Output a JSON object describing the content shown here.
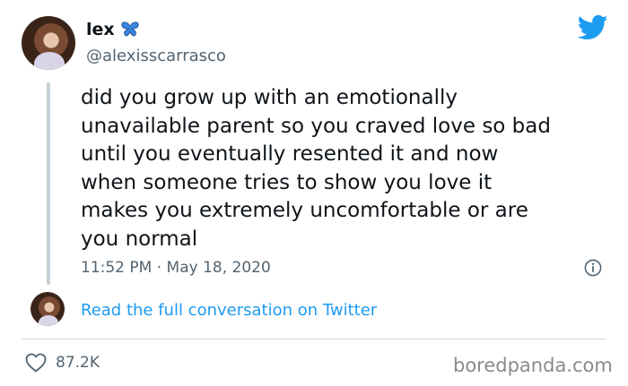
{
  "author": {
    "name": "lex",
    "handle": "@alexisscarrasco",
    "emoji_icon": "butterfly-icon"
  },
  "tweet": {
    "text": "did you grow up with an emotionally\nunavailable parent so you craved love so bad\nuntil you eventually resented it and now\nwhen someone tries to show you love it\nmakes you extremely uncomfortable or are\nyou normal",
    "timestamp": "11:52 PM · May 18, 2020"
  },
  "conversation_link": "Read the full conversation on Twitter",
  "footer": {
    "likes": "87.2K",
    "watermark": "boredpanda.com"
  },
  "colors": {
    "twitter_blue": "#1d9bf0",
    "text_primary": "#0f1419",
    "text_secondary": "#536471",
    "thread_line": "#c4cfd6"
  }
}
